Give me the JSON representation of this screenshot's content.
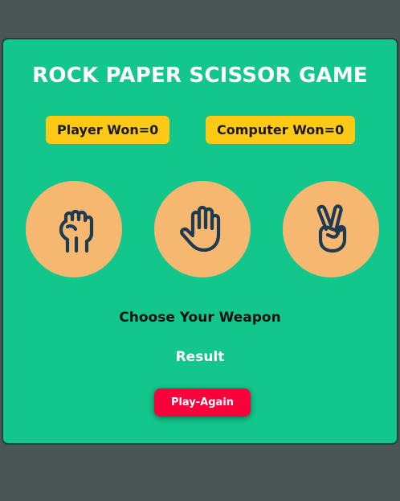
{
  "title": "ROCK PAPER SCISSOR GAME",
  "scores": {
    "player_label": "Player Won=0",
    "computer_label": "Computer Won=0"
  },
  "choices": [
    {
      "name": "rock",
      "icon": "fist-icon"
    },
    {
      "name": "paper",
      "icon": "open-hand-icon"
    },
    {
      "name": "scissor",
      "icon": "victory-hand-icon"
    }
  ],
  "message": "Choose Your Weapon",
  "result": "Result",
  "play_again_label": "Play-Again",
  "colors": {
    "background": "#4a5656",
    "card": "#13c68c",
    "score_badge": "#fcca14",
    "choice_circle": "#f6b870",
    "icon_stroke": "#1f3b52",
    "button": "#f8023c"
  }
}
